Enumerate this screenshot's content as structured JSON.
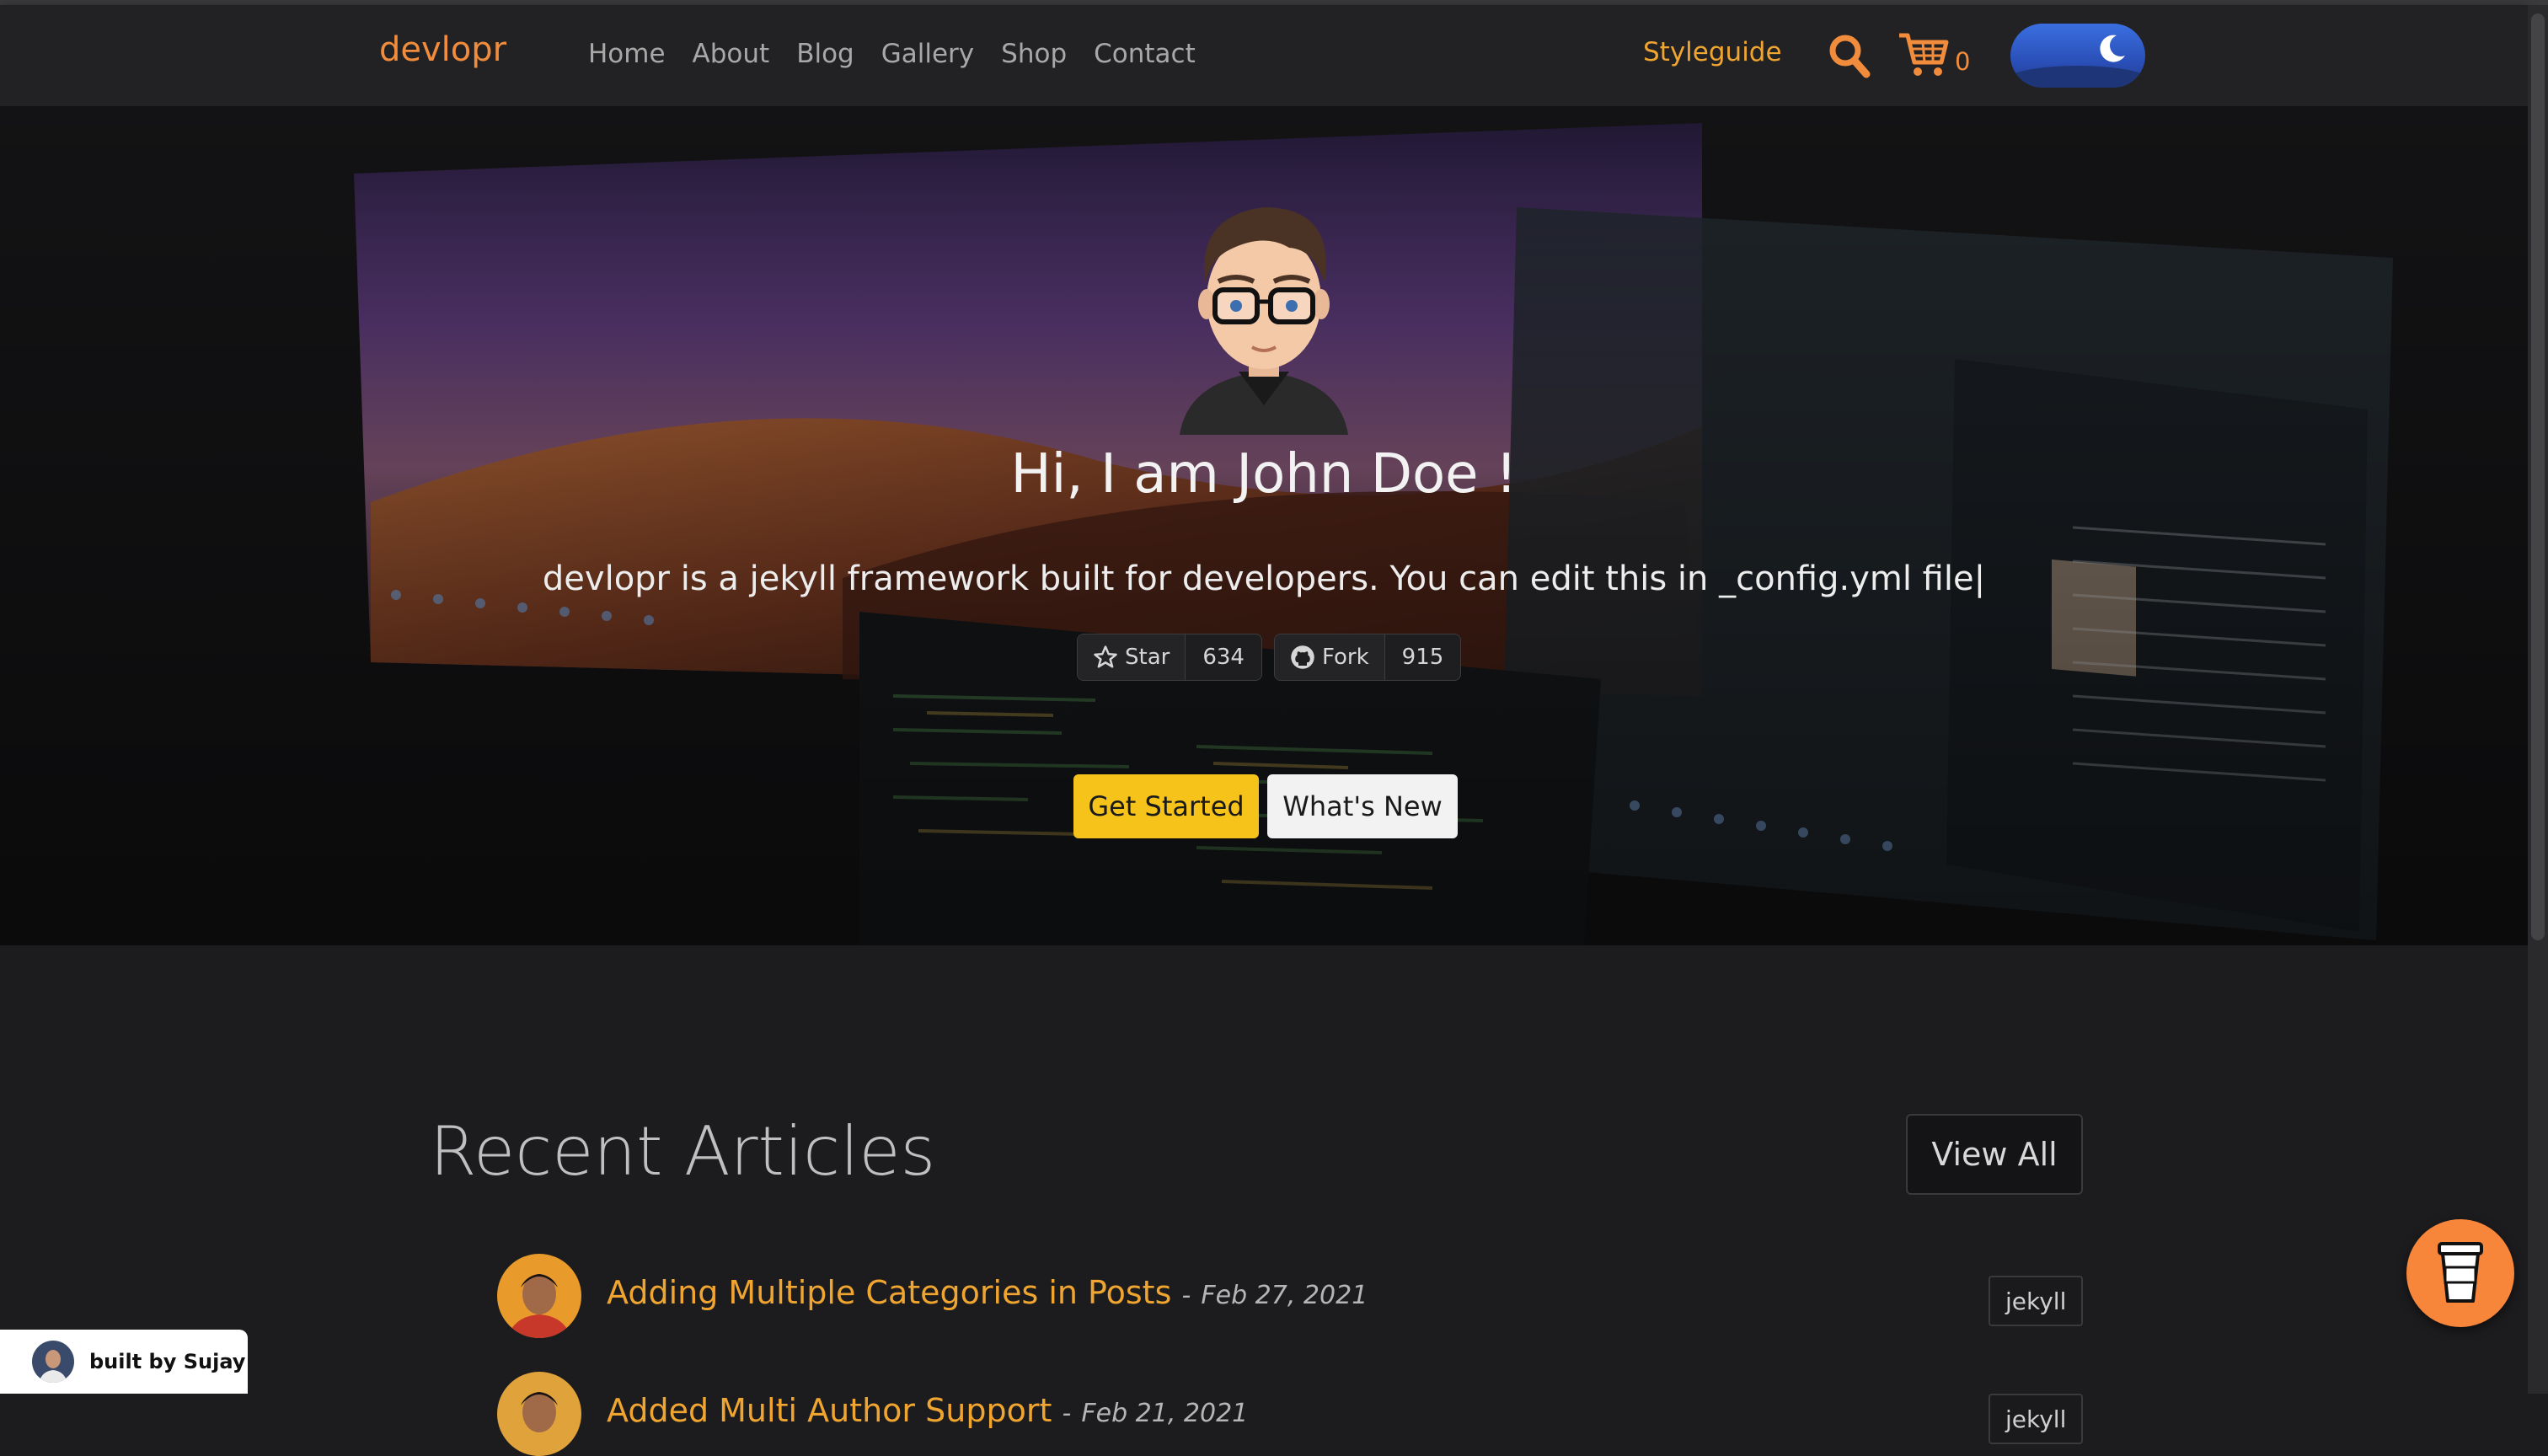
{
  "navbar": {
    "brand": "devlopr",
    "links": [
      "Home",
      "About",
      "Blog",
      "Gallery",
      "Shop",
      "Contact"
    ],
    "styleguide": "Styleguide",
    "cart_count": "0"
  },
  "hero": {
    "title": "Hi, I am John Doe !",
    "subtitle": "devlopr is a jekyll framework built for developers. You can edit this in _config.yml file|",
    "star": {
      "label": "Star",
      "count": "634"
    },
    "fork": {
      "label": "Fork",
      "count": "915"
    },
    "primary_cta": "Get Started",
    "secondary_cta": "What's New"
  },
  "recent": {
    "title": "Recent Articles",
    "view_all": "View All",
    "articles": [
      {
        "title": "Adding Multiple Categories in Posts",
        "separator": "-",
        "date": "Feb 27, 2021",
        "tag": "jekyll"
      },
      {
        "title": "Added Multi Author Support",
        "separator": "-",
        "date": "Feb 21, 2021",
        "tag": "jekyll"
      }
    ]
  },
  "footer_badge": {
    "text": "built by Sujay"
  },
  "colors": {
    "accent": "#f08c3c",
    "link": "#f0a530",
    "primary_button": "#f6c31a",
    "background": "#1c1c1e"
  },
  "icons": {
    "search": "search-icon",
    "cart": "cart-icon",
    "theme": "moon-icon",
    "star": "star-icon",
    "fork": "github-icon",
    "coffee": "coffee-cup-icon"
  }
}
